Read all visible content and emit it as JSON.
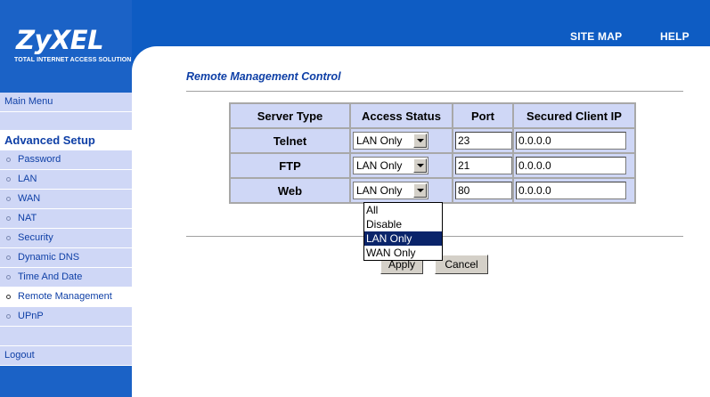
{
  "header": {
    "site_map": "SITE MAP",
    "help": "HELP"
  },
  "logo": {
    "name": "ZyXEL",
    "tagline": "Total Internet Access Solution"
  },
  "sidebar": {
    "main_menu": "Main Menu",
    "section": "Advanced Setup",
    "items": [
      {
        "label": "Password"
      },
      {
        "label": "LAN"
      },
      {
        "label": "WAN"
      },
      {
        "label": "NAT"
      },
      {
        "label": "Security"
      },
      {
        "label": "Dynamic DNS"
      },
      {
        "label": "Time And Date"
      },
      {
        "label": "Remote Management"
      },
      {
        "label": "UPnP"
      }
    ],
    "logout": "Logout"
  },
  "page": {
    "title": "Remote Management Control"
  },
  "table": {
    "headers": [
      "Server Type",
      "Access Status",
      "Port",
      "Secured Client IP"
    ],
    "rows": [
      {
        "server": "Telnet",
        "access": "LAN Only",
        "port": "23",
        "ip": "0.0.0.0"
      },
      {
        "server": "FTP",
        "access": "LAN Only",
        "port": "21",
        "ip": "0.0.0.0"
      },
      {
        "server": "Web",
        "access": "LAN Only",
        "port": "80",
        "ip": "0.0.0.0"
      }
    ]
  },
  "dropdown": {
    "options": [
      "All",
      "Disable",
      "LAN Only",
      "WAN Only"
    ],
    "selected": "LAN Only"
  },
  "buttons": {
    "apply": "Apply",
    "cancel": "Cancel"
  },
  "colors": {
    "brand_blue": "#0e5cc3",
    "sidebar_row": "#cfd7f6",
    "title_text": "#0e3fa6",
    "selection": "#0a246a"
  }
}
